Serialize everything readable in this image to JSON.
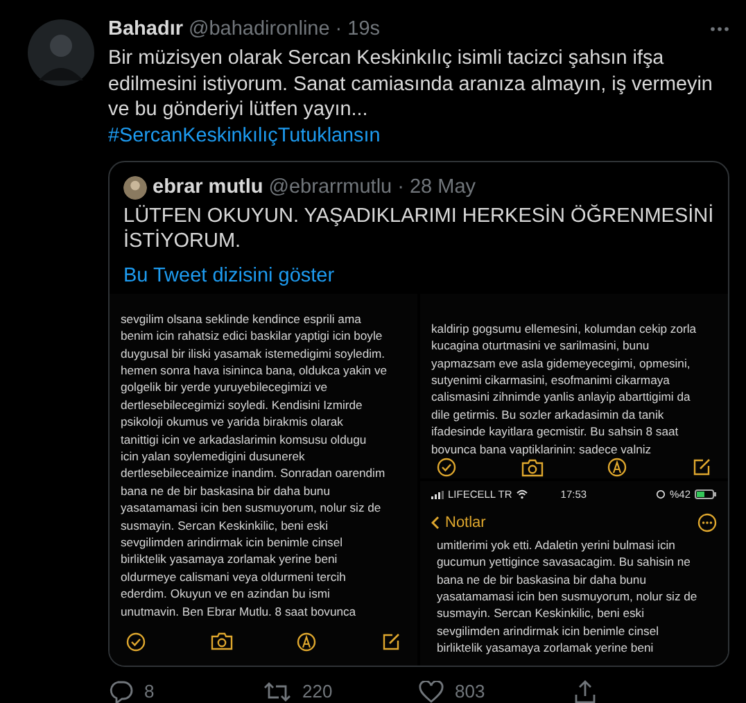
{
  "tweet": {
    "name": "Bahadır",
    "handle": "@bahadironline",
    "time": "· 19s",
    "text": "Bir müzisyen olarak Sercan Keskinkılıç isimli tacizci şahsın ifşa edilmesini istiyorum. Sanat camiasında aranıza almayın, iş vermeyin ve bu gönderiyi lütfen yayın...",
    "hashtag": "#SercanKeskinkılıçTutuklansın",
    "quote": {
      "name": "ebrar mutlu",
      "handle": "@ebrarrmutlu",
      "time": "· 28 May",
      "text": "LÜTFEN OKUYUN. YAŞADIKLARIMI HERKESİN ÖĞRENMESİNİ İSTİYORUM.",
      "thread_link": "Bu Tweet dizisini göster",
      "images": [
        {
          "kind": "note",
          "lines": [
            "sevgilim olsana seklinde kendince esprili ama",
            "benim icin rahatsiz edici baskilar yaptigi icin boyle",
            "duygusal bir iliski yasamak istemedigimi soyledim.",
            "hemen sonra hava isininca bana, oldukca yakin ve",
            "golgelik bir yerde yuruyebilecegimizi ve",
            "dertlesebilecegimizi soyledi. Kendisini Izmirde",
            "psikoloji okumus ve yarida birakmis olarak",
            "tanittigi icin ve arkadaslarimin komsusu oldugu",
            "icin yalan soylemedigini dusunerek",
            "dertlesebileceaimize inandim. Sonradan oarendim",
            "bana ne de bir baskasina bir daha bunu",
            "yasatamamasi icin ben susmuyorum, nolur siz de",
            "susmayin. Sercan Keskinkilic, beni eski",
            "sevgilimden arindirmak icin benimle cinsel",
            "birliktelik yasamaya zorlamak yerine beni",
            "oldurmeye calismani veya oldurmeni tercih",
            "ederdim. Okuyun ve en azindan bu ismi",
            "unutmavin. Ben Ebrar Mutlu. 8 saat bovunca"
          ]
        },
        {
          "kind": "note",
          "lines": [
            "kaldirip gogsumu ellemesini, kolumdan cekip zorla",
            "kucagina oturtmasini ve sarilmasini, bunu",
            "yapmazsam eve asla gidemeyecegimi, opmesini,",
            "sutyenimi cikarmasini, esofmanimi cikarmaya",
            "calismasini zihnimde yanlis anlayip abarttigimi da",
            "dile getirmis. Bu sozler arkadasimin da tanik",
            "ifadesinde kayitlara gecmistir. Bu sahsin 8 saat",
            "bovunca bana vaptiklarinin: sadece valniz"
          ]
        },
        {
          "kind": "phone",
          "carrier": "LIFECELL TR",
          "clock": "17:53",
          "battery": "%42",
          "back": "Notlar",
          "lines": [
            "umitlerimi yok etti. Adaletin yerini bulmasi icin",
            "gucumun yettigince savasacagim. Bu sahisin ne",
            "bana ne de bir baskasina bir daha bunu",
            "yasatamamasi icin ben susmuyorum, nolur siz de",
            "susmayin. Sercan Keskinkilic, beni eski",
            "sevgilimden arindirmak icin benimle cinsel",
            "birliktelik yasamaya zorlamak yerine beni"
          ]
        }
      ]
    },
    "actions": [
      {
        "kind": "reply",
        "count": "8"
      },
      {
        "kind": "retweet",
        "count": "220"
      },
      {
        "kind": "like",
        "count": "803"
      },
      {
        "kind": "share"
      }
    ]
  }
}
